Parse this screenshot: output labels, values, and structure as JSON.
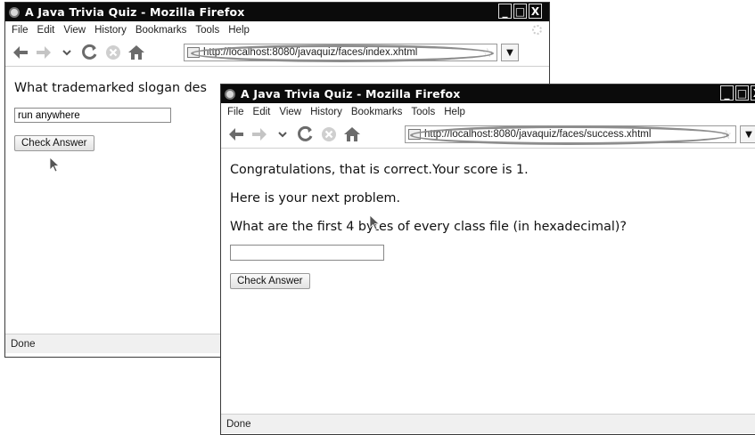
{
  "window_back": {
    "title": "A Java Trivia Quiz - Mozilla Firefox",
    "menu": [
      "File",
      "Edit",
      "View",
      "History",
      "Bookmarks",
      "Tools",
      "Help"
    ],
    "url": "http://localhost:8080/javaquiz/faces/index.xhtml",
    "question": "What trademarked slogan des",
    "answer_value": "run anywhere",
    "check_button": "Check Answer",
    "status": "Done"
  },
  "window_front": {
    "title": "A Java Trivia Quiz - Mozilla Firefox",
    "menu": [
      "File",
      "Edit",
      "View",
      "History",
      "Bookmarks",
      "Tools",
      "Help"
    ],
    "url": "http://localhost:8080/javaquiz/faces/success.xhtml",
    "message": "Congratulations, that is correct.Your score is 1.",
    "next_problem": "Here is your next problem.",
    "question": "What are the first 4 bytes of every class file (in hexadecimal)?",
    "answer_value": "",
    "check_button": "Check Answer",
    "status": "Done"
  },
  "window_buttons": [
    "_",
    "□",
    "X"
  ],
  "icons": {
    "back": "back-arrow-icon",
    "forward": "forward-arrow-icon",
    "history_dropdown": "chevron-down-icon",
    "reload": "reload-icon",
    "stop": "stop-icon",
    "home": "home-icon",
    "bookmark_star": "star-icon"
  },
  "colors": {
    "titlebar": "#0b0b0b",
    "highlight_ellipse": "#8d8d8d"
  }
}
